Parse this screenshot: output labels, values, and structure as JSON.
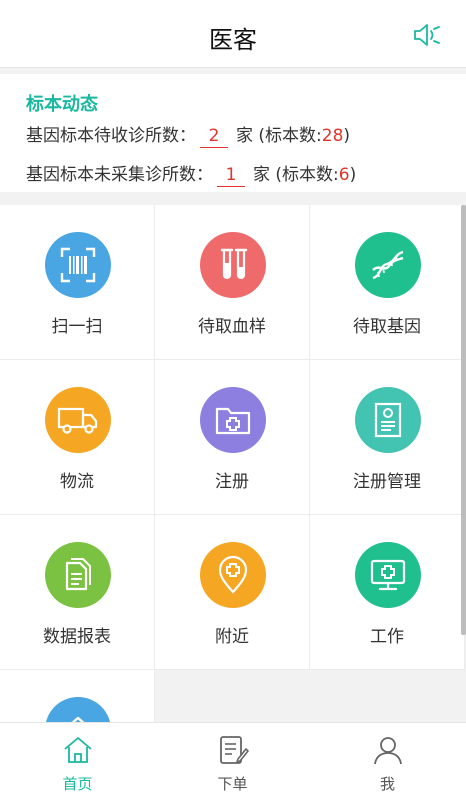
{
  "header": {
    "title": "医客",
    "speaker_icon": "speaker-icon"
  },
  "status": {
    "title": "标本动态",
    "line1": {
      "prefix": "基因标本待收诊所数：",
      "count": "2",
      "unit": "家",
      "sample_prefix": "(标本数:",
      "sample_count": "28",
      "sample_suffix": ")"
    },
    "line2": {
      "prefix": "基因标本未采集诊所数：",
      "count": "1",
      "unit": "家",
      "sample_prefix": "(标本数:",
      "sample_count": "6",
      "sample_suffix": ")"
    }
  },
  "grid": [
    {
      "label": "扫一扫",
      "icon": "barcode-scan-icon",
      "color": "#4aa6e3"
    },
    {
      "label": "待取血样",
      "icon": "test-tubes-icon",
      "color": "#ef6b6b"
    },
    {
      "label": "待取基因",
      "icon": "dna-icon",
      "color": "#20c08e"
    },
    {
      "label": "物流",
      "icon": "truck-icon",
      "color": "#f5a623"
    },
    {
      "label": "注册",
      "icon": "medical-folder-icon",
      "color": "#8c7fe0"
    },
    {
      "label": "注册管理",
      "icon": "registration-document-icon",
      "color": "#43c3b1"
    },
    {
      "label": "数据报表",
      "icon": "report-documents-icon",
      "color": "#7cc242"
    },
    {
      "label": "附近",
      "icon": "location-pin-icon",
      "color": "#f5a623"
    },
    {
      "label": "工作",
      "icon": "monitor-medical-icon",
      "color": "#20c08e"
    },
    {
      "label": "",
      "icon": "home-icon",
      "color": "#4aa6e3"
    }
  ],
  "tabbar": [
    {
      "label": "首页",
      "icon": "home-icon",
      "active": true
    },
    {
      "label": "下单",
      "icon": "order-form-icon",
      "active": false
    },
    {
      "label": "我",
      "icon": "user-icon",
      "active": false
    }
  ],
  "colors": {
    "accent": "#1ab8a0",
    "alert": "#e0342c"
  }
}
